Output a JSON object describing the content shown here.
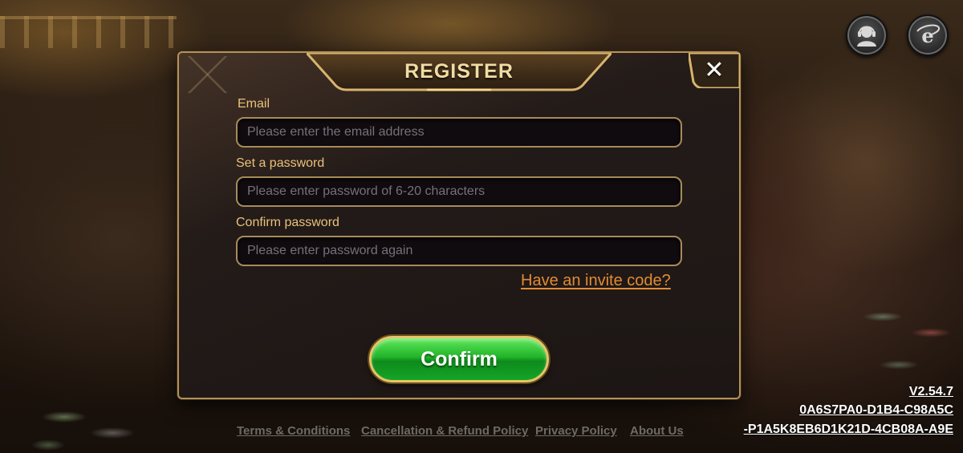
{
  "dialog": {
    "title": "REGISTER",
    "close_glyph": "✕"
  },
  "form": {
    "email": {
      "label": "Email",
      "value": "",
      "placeholder": "Please enter the email address"
    },
    "password": {
      "label": "Set a password",
      "value": "",
      "placeholder": "Please enter password of 6-20 characters"
    },
    "confirm_password": {
      "label": "Confirm password",
      "value": "",
      "placeholder": "Please enter password again"
    },
    "invite_link": "Have an invite code?",
    "confirm_label": "Confirm"
  },
  "top_icons": [
    {
      "name": "customer-support-icon"
    },
    {
      "name": "browser-icon"
    }
  ],
  "footer": {
    "links": [
      "Terms & Conditions",
      "Cancellation & Refund Policy",
      "Privacy Policy",
      "About Us"
    ]
  },
  "version": {
    "number": "V2.54.7",
    "id_line1": "0A6S7PA0-D1B4-C98A5C",
    "id_line2": "-P1A5K8EB6D1K21D-4CB08A-A9E"
  },
  "colors": {
    "accent_gold": "#e9c27a",
    "link_orange": "#e08c34",
    "confirm_green": "#21b32a",
    "panel_dark": "#1c1614"
  }
}
